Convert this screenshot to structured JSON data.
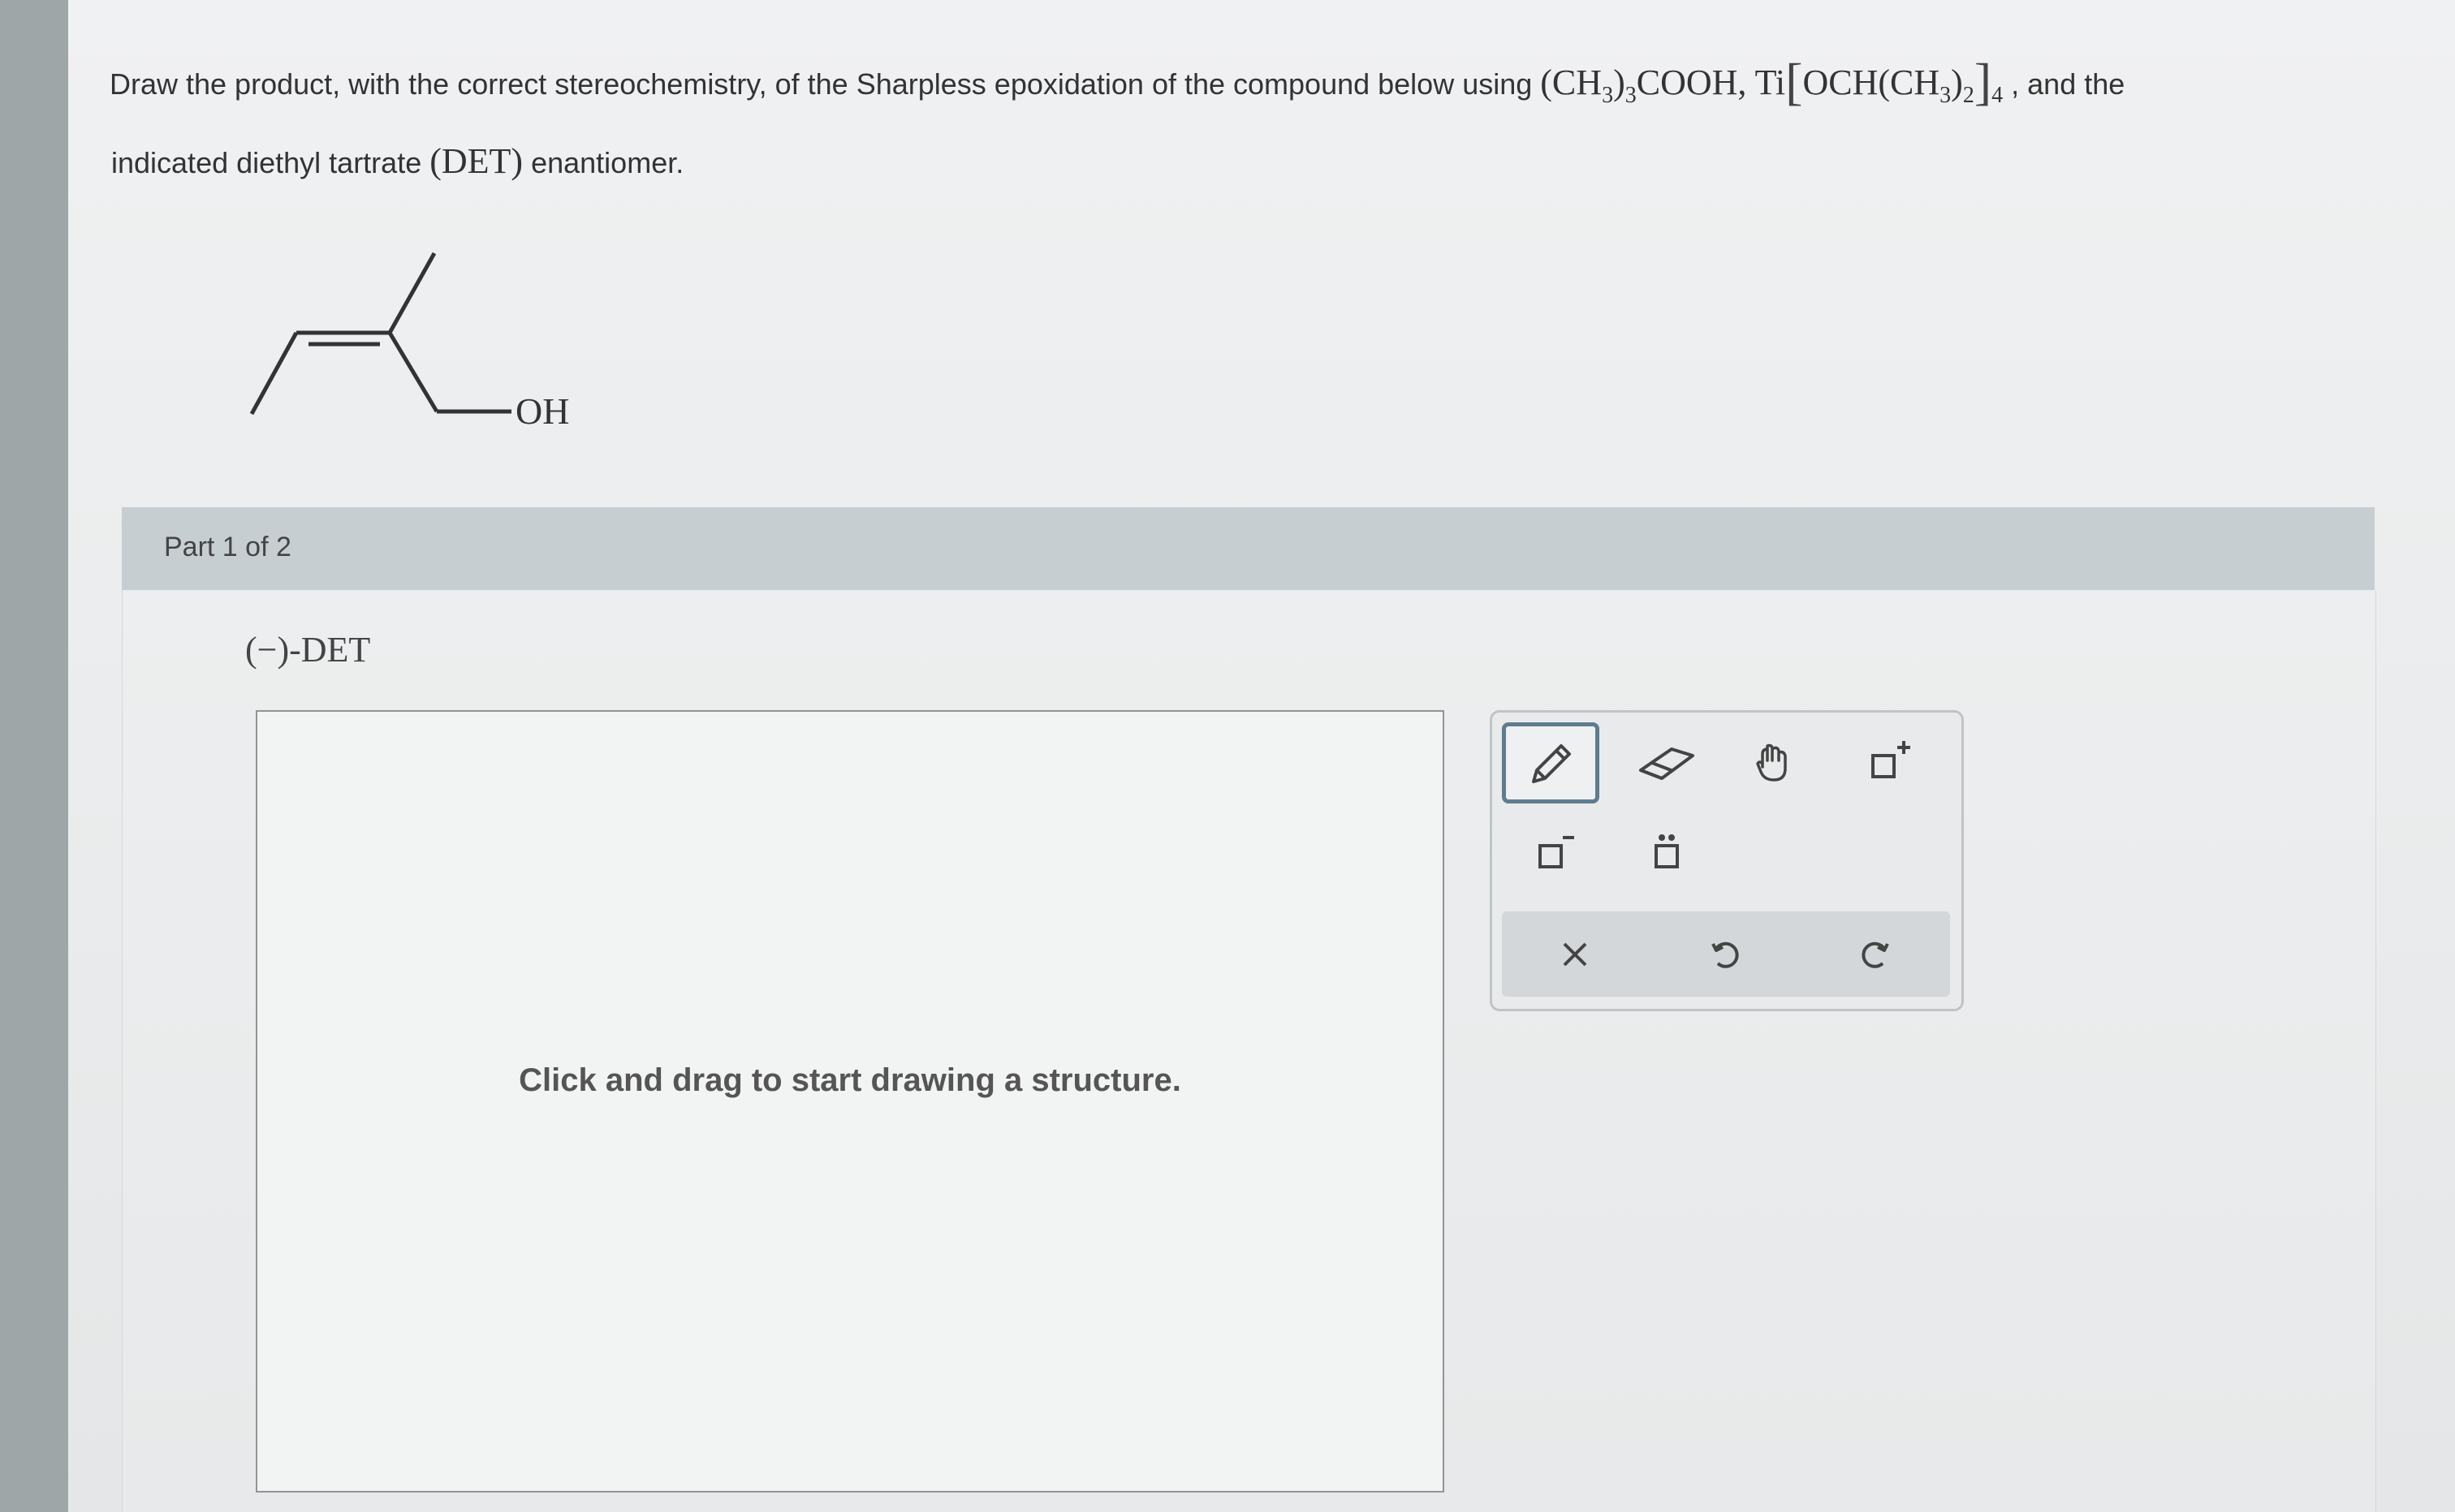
{
  "question": {
    "line1_start": "Draw the product, with the correct stereochemistry, of the Sharpless epoxidation of the compound below using",
    "reagent1": "(CH",
    "reagent1_sub": "3",
    "reagent1_close": ")",
    "reagent1_sub2": "3",
    "reagent1_end": "COOH, Ti",
    "reagent2": "OCH(CH",
    "reagent2_sub": "3",
    "reagent2_close": ")",
    "reagent2_sub2": "2",
    "reagent2_sub3": "4",
    "line1_end": ", and the",
    "line2_start": "indicated diethyl tartrate",
    "line2_abbrev": "(DET)",
    "line2_end": "enantiomer."
  },
  "molecule": {
    "substituent_label": "OH"
  },
  "part": {
    "label": "Part 1 of 2",
    "reagent": "(−)-DET"
  },
  "canvas": {
    "hint": "Click and drag to start drawing a structure."
  },
  "toolbar": {
    "tools": [
      "pencil-icon",
      "eraser-icon",
      "hand-icon",
      "charge-plus-icon",
      "charge-minus-icon",
      "lone-pair-icon"
    ],
    "actions": [
      "clear-icon",
      "undo-icon",
      "redo-icon"
    ],
    "active_tool": "pencil-icon"
  }
}
